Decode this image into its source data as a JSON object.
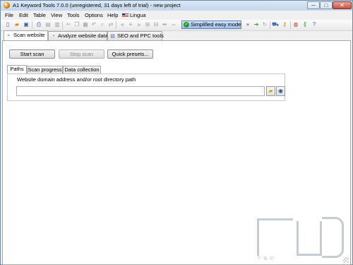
{
  "window": {
    "title": "A1 Keyword Tools 7.0.0 (unregistered, 31 days left of trial) - new project"
  },
  "title_buttons": {
    "minimize": "─",
    "maximize": "□",
    "close": "✕"
  },
  "menu": {
    "items": [
      "File",
      "Edit",
      "Table",
      "View",
      "Tools",
      "Options",
      "Help",
      "Lingua"
    ]
  },
  "toolbar": {
    "icons": [
      "new-file",
      "open-folder",
      "save",
      "print",
      "cut",
      "copy",
      "paste",
      "undo",
      "find",
      "replace",
      "tool-a",
      "tool-b",
      "tool-c",
      "tool-d",
      "tool-e",
      "tool-f",
      "tool-g"
    ],
    "easy_mode_label": "Simplified easy mode",
    "right_icons": [
      "stop",
      "go",
      "refresh",
      "cart",
      "key",
      "world",
      "share",
      "help"
    ]
  },
  "main_tabs": [
    {
      "label": "Scan website",
      "active": true
    },
    {
      "label": "Analyze website data",
      "active": false
    },
    {
      "label": "SEO and PPC tools",
      "active": false
    }
  ],
  "actions": {
    "start_scan": "Start scan",
    "stop_scan": "Stop scan",
    "quick_presets": "Quick presets..."
  },
  "sub_tabs": [
    {
      "label": "Paths",
      "active": true
    },
    {
      "label": "Scan progress",
      "active": false
    },
    {
      "label": "Data collection",
      "active": false
    }
  ],
  "paths": {
    "field_label": "Website domain address and/or root directory path",
    "field_value": ""
  },
  "watermark": {
    "text": "下载吧"
  },
  "colors": {
    "accent": "#9ebfe8",
    "title_bar": "#c3d6ec",
    "close": "#c8513d"
  }
}
